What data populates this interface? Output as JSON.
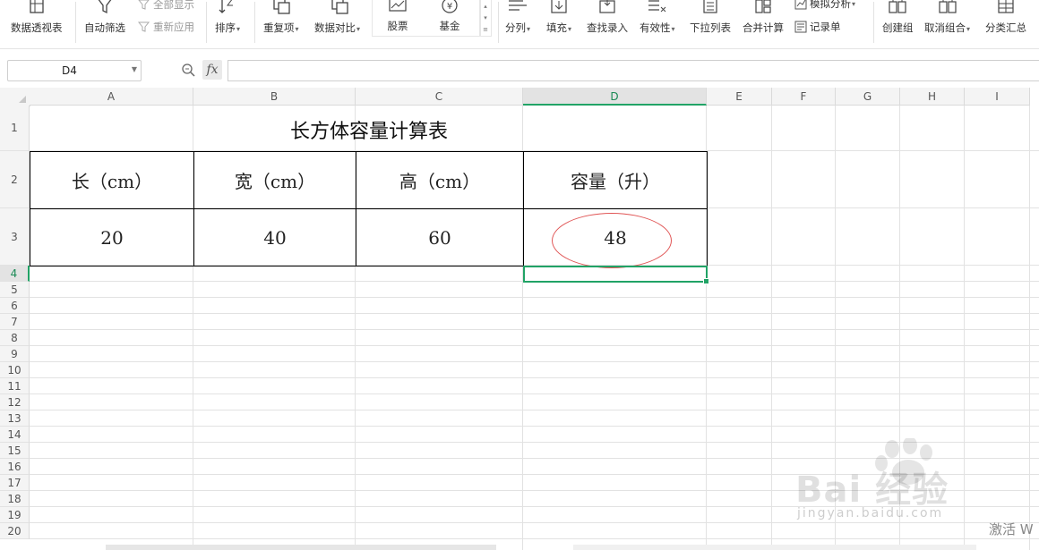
{
  "ribbon": {
    "pivot_table": "数据透视表",
    "auto_filter": "自动筛选",
    "show_all": "全部显示",
    "reapply": "重新应用",
    "sort": "排序",
    "duplicates": "重复项",
    "data_compare": "数据对比",
    "stocks": "股票",
    "funds": "基金",
    "split_column": "分列",
    "fill": "填充",
    "find_entry": "查找录入",
    "validity": "有效性",
    "dropdown_list": "下拉列表",
    "merge_calc": "合并计算",
    "what_if": "模拟分析",
    "record_form": "记录单",
    "create_group": "创建组",
    "ungroup": "取消组合",
    "subtotal": "分类汇总"
  },
  "formula_bar": {
    "name_box": "D4",
    "fx": "fx",
    "formula": ""
  },
  "columns": [
    "A",
    "B",
    "C",
    "D",
    "E",
    "F",
    "G",
    "H",
    "I"
  ],
  "rows": [
    "1",
    "2",
    "3",
    "4",
    "5",
    "6",
    "7",
    "8",
    "9",
    "10",
    "11",
    "12",
    "13",
    "14",
    "15",
    "16",
    "17",
    "18",
    "19",
    "20"
  ],
  "table": {
    "title": "长方体容量计算表",
    "headers": [
      "长（cm）",
      "宽（cm）",
      "高（cm）",
      "容量（升）"
    ],
    "values": [
      "20",
      "40",
      "60",
      "48"
    ]
  },
  "watermark": {
    "brand": "Bai 经验",
    "url": "jingyan.baidu.com"
  },
  "activation_text": "激活 W"
}
